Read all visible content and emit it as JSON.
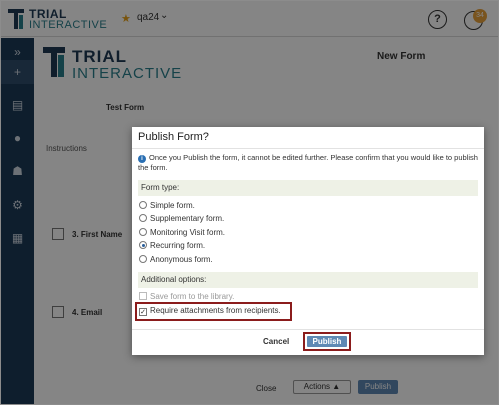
{
  "app": {
    "logo_top": "TRIAL",
    "logo_bottom": "INTERACTIVE",
    "user": "qa24",
    "timer_badge": "34"
  },
  "page": {
    "title": "New Form",
    "form_name": "Test Form",
    "instructions_label": "Instructions",
    "questions": [
      "3. First Name",
      "4. Email"
    ],
    "footer": {
      "close": "Close",
      "actions": "Actions",
      "publish": "Publish"
    }
  },
  "modal": {
    "title": "Publish Form?",
    "info": "Once you Publish the form, it cannot be edited further. Please confirm that you would like to publish the form.",
    "form_type_label": "Form type:",
    "form_types": [
      {
        "label": "Simple form.",
        "selected": false
      },
      {
        "label": "Supplementary form.",
        "selected": false
      },
      {
        "label": "Monitoring Visit form.",
        "selected": false
      },
      {
        "label": "Recurring form.",
        "selected": true
      },
      {
        "label": "Anonymous form.",
        "selected": false
      }
    ],
    "additional_label": "Additional options:",
    "options": [
      {
        "label": "Save form to the library.",
        "checked": false,
        "disabled": true
      },
      {
        "label": "Require attachments from recipients.",
        "checked": true,
        "disabled": false
      }
    ],
    "cancel": "Cancel",
    "publish": "Publish"
  },
  "colors": {
    "sidebar": "#1c3a57",
    "brand_teal": "#2a7f8c",
    "primary_button": "#5f89b4",
    "highlight": "#8b1c1c"
  }
}
